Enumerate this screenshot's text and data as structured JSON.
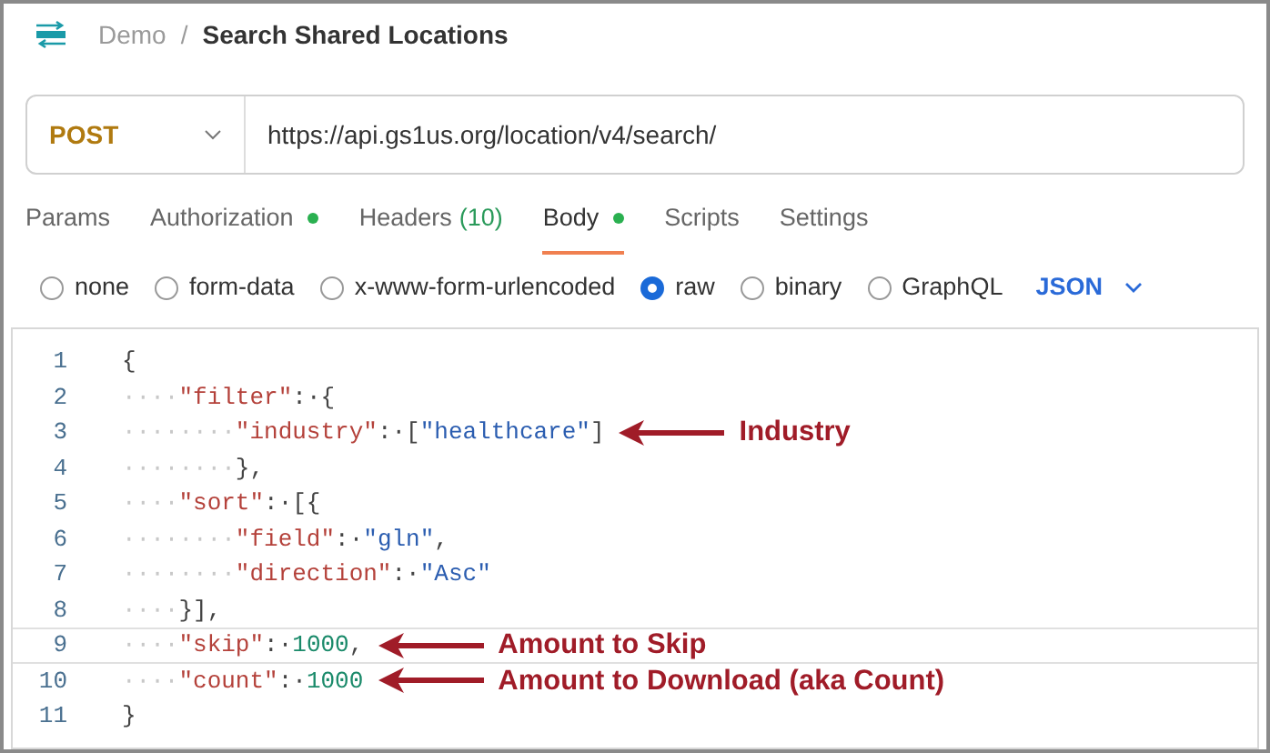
{
  "breadcrumb": {
    "collection": "Demo",
    "separator": "/",
    "request": "Search Shared Locations"
  },
  "request": {
    "method": "POST",
    "url": "https://api.gs1us.org/location/v4/search/"
  },
  "tabs": [
    {
      "label": "Params",
      "selected": false
    },
    {
      "label": "Authorization",
      "selected": false,
      "dot": true
    },
    {
      "label": "Headers",
      "count": "(10)",
      "selected": false
    },
    {
      "label": "Body",
      "selected": true,
      "dot": true
    },
    {
      "label": "Scripts",
      "selected": false
    },
    {
      "label": "Settings",
      "selected": false
    }
  ],
  "body_types": [
    {
      "label": "none",
      "selected": false
    },
    {
      "label": "form-data",
      "selected": false
    },
    {
      "label": "x-www-form-urlencoded",
      "selected": false
    },
    {
      "label": "raw",
      "selected": true
    },
    {
      "label": "binary",
      "selected": false
    },
    {
      "label": "GraphQL",
      "selected": false
    }
  ],
  "format": "JSON",
  "editor": {
    "lines": [
      {
        "number": "1",
        "selected": false,
        "tokens": [
          {
            "kind": "punct",
            "text": "{"
          }
        ]
      },
      {
        "number": "2",
        "selected": false,
        "tokens": [
          {
            "kind": "space",
            "text": "····"
          },
          {
            "kind": "key",
            "text": "\"filter\""
          },
          {
            "kind": "punct",
            "text": ":·{"
          }
        ]
      },
      {
        "number": "3",
        "selected": false,
        "tokens": [
          {
            "kind": "space",
            "text": "········"
          },
          {
            "kind": "key",
            "text": "\"industry\""
          },
          {
            "kind": "punct",
            "text": ":·["
          },
          {
            "kind": "string",
            "text": "\"healthcare\""
          },
          {
            "kind": "punct",
            "text": "]"
          }
        ],
        "annotation": "Industry"
      },
      {
        "number": "4",
        "selected": false,
        "tokens": [
          {
            "kind": "space",
            "text": "········"
          },
          {
            "kind": "punct",
            "text": "},"
          }
        ]
      },
      {
        "number": "5",
        "selected": false,
        "tokens": [
          {
            "kind": "space",
            "text": "····"
          },
          {
            "kind": "key",
            "text": "\"sort\""
          },
          {
            "kind": "punct",
            "text": ":·[{"
          }
        ]
      },
      {
        "number": "6",
        "selected": false,
        "tokens": [
          {
            "kind": "space",
            "text": "········"
          },
          {
            "kind": "key",
            "text": "\"field\""
          },
          {
            "kind": "punct",
            "text": ":·"
          },
          {
            "kind": "string",
            "text": "\"gln\""
          },
          {
            "kind": "punct",
            "text": ","
          }
        ]
      },
      {
        "number": "7",
        "selected": false,
        "tokens": [
          {
            "kind": "space",
            "text": "········"
          },
          {
            "kind": "key",
            "text": "\"direction\""
          },
          {
            "kind": "punct",
            "text": ":·"
          },
          {
            "kind": "string",
            "text": "\"Asc\""
          }
        ]
      },
      {
        "number": "8",
        "selected": false,
        "tokens": [
          {
            "kind": "space",
            "text": "····"
          },
          {
            "kind": "punct",
            "text": "}],"
          }
        ]
      },
      {
        "number": "9",
        "selected": true,
        "tokens": [
          {
            "kind": "space",
            "text": "····"
          },
          {
            "kind": "key",
            "text": "\"skip\""
          },
          {
            "kind": "punct",
            "text": ":·"
          },
          {
            "kind": "number",
            "text": "1000"
          },
          {
            "kind": "punct",
            "text": ","
          }
        ],
        "annotation": "Amount to Skip"
      },
      {
        "number": "10",
        "selected": false,
        "tokens": [
          {
            "kind": "space",
            "text": "····"
          },
          {
            "kind": "key",
            "text": "\"count\""
          },
          {
            "kind": "punct",
            "text": ":·"
          },
          {
            "kind": "number",
            "text": "1000"
          }
        ],
        "annotation": "Amount to Download (aka Count)"
      },
      {
        "number": "11",
        "selected": false,
        "tokens": [
          {
            "kind": "punct",
            "text": "}"
          }
        ]
      }
    ]
  }
}
